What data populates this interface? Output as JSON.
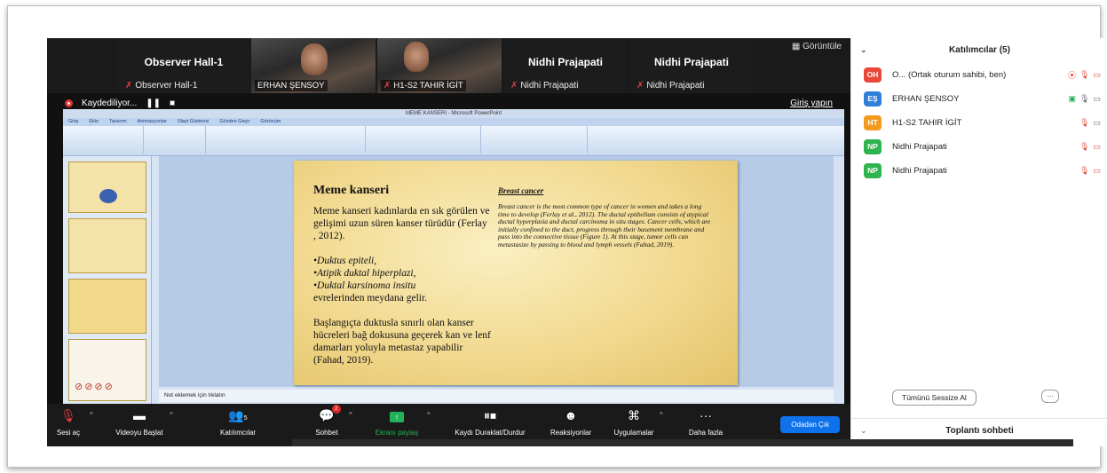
{
  "video_strip": {
    "tiles": [
      {
        "big": "Observer Hall-1",
        "small": "Observer Hall-1"
      },
      {
        "chip": "ERHAN ŞENSOY"
      },
      {
        "chip": "H1-S2 TAHIR İGİT"
      },
      {
        "big": "Nidhi Prajapati",
        "small": "Nidhi Prajapati"
      },
      {
        "big": "Nidhi Prajapati",
        "small": "Nidhi Prajapati"
      }
    ],
    "view_label": "Görüntüle"
  },
  "recording": {
    "label": "Kaydediliyor...",
    "login_link": "Giriş yapın"
  },
  "powerpoint": {
    "window_title": "MEME KANSERI - Microsoft PowerPoint",
    "ribbon_tabs": [
      "Giriş",
      "Ekle",
      "Tasarım",
      "Animasyonlar",
      "Slayt Gösterisi",
      "Gözden Geçir",
      "Görünüm"
    ],
    "notes_placeholder": "Not eklemek için tıklatın",
    "slide": {
      "title_tr": "Meme kanseri",
      "title_en": "Breast cancer",
      "para1": "Meme kanseri kadınlarda en sık görülen ve gelişimi uzun süren kanser türüdür (Ferlay , 2012).",
      "list": [
        "•Duktus epiteli,",
        "•Atipik duktal hiperplazi,",
        "•Duktal karsinoma insitu"
      ],
      "list_tail": "evrelerinden meydana gelir.",
      "para2": "Başlangıçta duktusla sınırlı olan kanser hücreleri bağ dokusuna geçerek kan ve lenf damarları yoluyla metastaz yapabilir (Fahad, 2019).",
      "right_text": "Breast cancer is the most common type of cancer in women and takes a long time to develop (Ferlay et al., 2012). The ductal epithelium consists of atypical ductal hyperplasia and ductal carcinoma in situ stages. Cancer cells, which are initially confined to the duct, progress through their basement membrane and pass into the connective tissue (Figure 1). At this stage, tumor cells can metastasize by passing to blood and lymph vessels (Fahad, 2019)."
    }
  },
  "toolbar": {
    "items": [
      {
        "label": "Sesi aç",
        "icon": "mic-muted-icon"
      },
      {
        "label": "Videoyu Başlat",
        "icon": "video-off-icon"
      },
      {
        "label": "Katılımcılar",
        "icon": "participants-icon",
        "count": "5"
      },
      {
        "label": "Sohbet",
        "icon": "chat-icon",
        "badge": "2"
      },
      {
        "label": "Ekranı paylaş",
        "icon": "share-screen-icon"
      },
      {
        "label": "Kaydı Duraklat/Durdur",
        "icon": "pause-stop-icon"
      },
      {
        "label": "Reaksiyonlar",
        "icon": "reaction-icon"
      },
      {
        "label": "Uygulamalar",
        "icon": "apps-icon"
      },
      {
        "label": "Daha fazla",
        "icon": "more-icon"
      }
    ],
    "leave_label": "Odadan Çık",
    "accent": "#0e72ed",
    "share_color": "#21b35a"
  },
  "participants_panel": {
    "title": "Katılımcılar (5)",
    "rows": [
      {
        "initials": "OH",
        "color": "#e8473a",
        "name": "O... (Ortak oturum sahibi, ben)"
      },
      {
        "initials": "EŞ",
        "color": "#2f7fd8",
        "name": "ERHAN ŞENSOY"
      },
      {
        "initials": "HT",
        "color": "#f39b1f",
        "name": "H1-S2 TAHIR İGİT"
      },
      {
        "initials": "NP",
        "color": "#2fb34e",
        "name": "Nidhi Prajapati"
      },
      {
        "initials": "NP",
        "color": "#2fb34e",
        "name": "Nidhi Prajapati"
      }
    ],
    "mute_all_label": "Tümünü Sessize Al",
    "more_label": "···",
    "chat_title": "Toplantı sohbeti"
  }
}
